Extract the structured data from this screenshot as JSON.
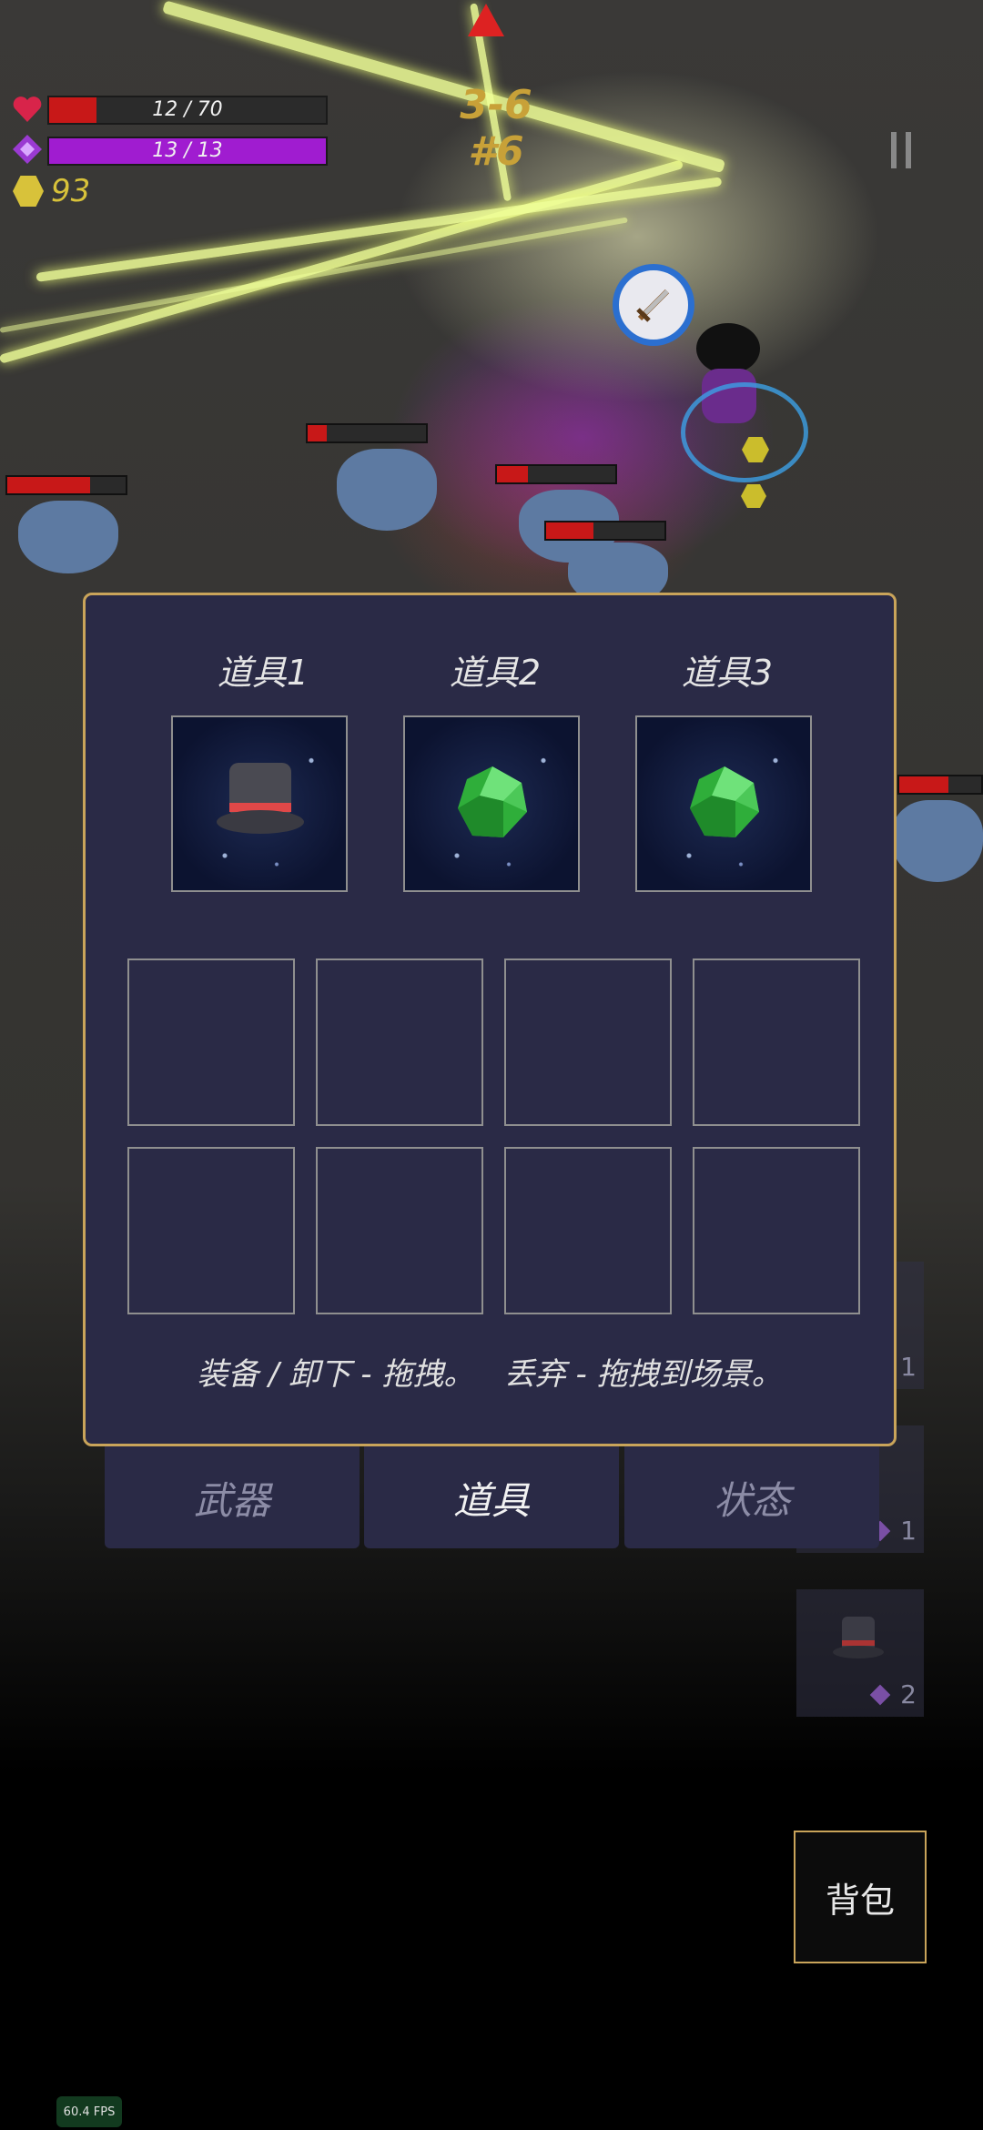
{
  "hud": {
    "hp": {
      "text": "12 / 70",
      "fraction": 0.171,
      "color": "#c81818"
    },
    "mp": {
      "text": "13 / 13",
      "fraction": 1.0,
      "color": "#a01cd0"
    },
    "gold": "93",
    "level": "3-6 #6"
  },
  "panel": {
    "slots": [
      {
        "label": "道具1",
        "icon": "top-hat-icon"
      },
      {
        "label": "道具2",
        "icon": "green-gem-icon"
      },
      {
        "label": "道具3",
        "icon": "green-gem-icon"
      }
    ],
    "instructions": "装备 / 卸下 - 拖拽。   丢弃 - 拖拽到场景。"
  },
  "tabs": [
    {
      "label": "武器",
      "active": false
    },
    {
      "label": "道具",
      "active": true
    },
    {
      "label": "状态",
      "active": false
    }
  ],
  "quick_slots": [
    {
      "count": "1",
      "icon": "weapon-icon"
    },
    {
      "count": "1",
      "icon": "item-icon"
    },
    {
      "count": "2",
      "icon": "top-hat-icon"
    }
  ],
  "bag_button": "背包",
  "fps": "60.4 FPS",
  "colors": {
    "accent": "#c9a45a",
    "panel": "#2a2a46"
  }
}
